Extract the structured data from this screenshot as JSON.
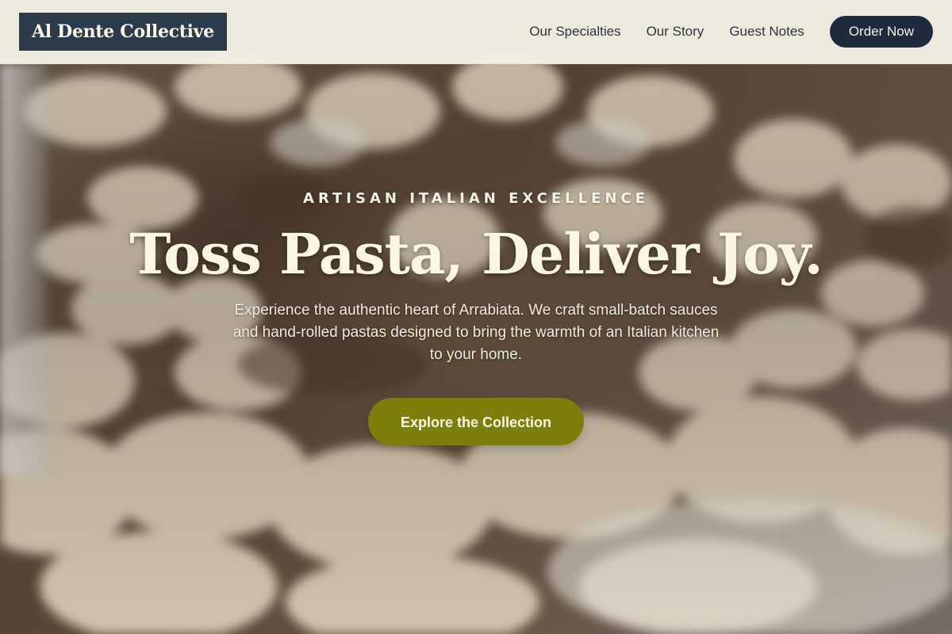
{
  "header": {
    "logo_text": "Al Dente Collective",
    "nav": {
      "items": [
        {
          "label": "Our Specialties"
        },
        {
          "label": "Our Story"
        },
        {
          "label": "Guest Notes"
        }
      ],
      "order_label": "Order Now"
    }
  },
  "hero": {
    "eyebrow": "ARTISAN ITALIAN EXCELLENCE",
    "headline": "Toss Pasta, Deliver Joy.",
    "description": "Experience the authentic heart of Arrabiata. We craft small-batch sauces and hand-rolled pastas designed to bring the warmth of an Italian kitchen to your home.",
    "cta_label": "Explore the Collection"
  },
  "colors": {
    "logo_bg": "#2d3a4a",
    "header_bg": "#f6f4e8",
    "order_button": "#1f2a3d",
    "cta_button": "#7d7f0c",
    "headline_text": "#fbf6e2"
  }
}
